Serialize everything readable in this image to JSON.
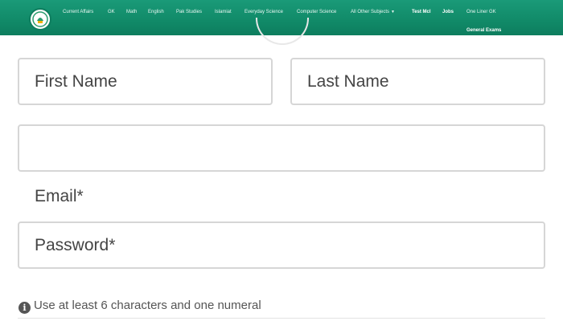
{
  "nav": {
    "items": [
      {
        "label": "Current Affairs"
      },
      {
        "label": "GK"
      },
      {
        "label": "Math"
      },
      {
        "label": "English"
      },
      {
        "label": "Pak Studies"
      },
      {
        "label": "Islamiat"
      },
      {
        "label": "Everyday Science"
      },
      {
        "label": "Computer Science"
      },
      {
        "label": "All Other Subjects"
      },
      {
        "label": "Test Mcl"
      },
      {
        "label": "Jobs"
      },
      {
        "label": "One Liner GK"
      },
      {
        "label": "General Exams"
      }
    ],
    "colors": {
      "bar": "#118a68",
      "text": "#ffffff"
    }
  },
  "form": {
    "first_name_placeholder": "First Name",
    "last_name_placeholder": "Last Name",
    "blank_field_value": "",
    "email_label": "Email*",
    "password_placeholder": "Password*",
    "hint_text": "Use at least 6 characters and one numeral"
  }
}
